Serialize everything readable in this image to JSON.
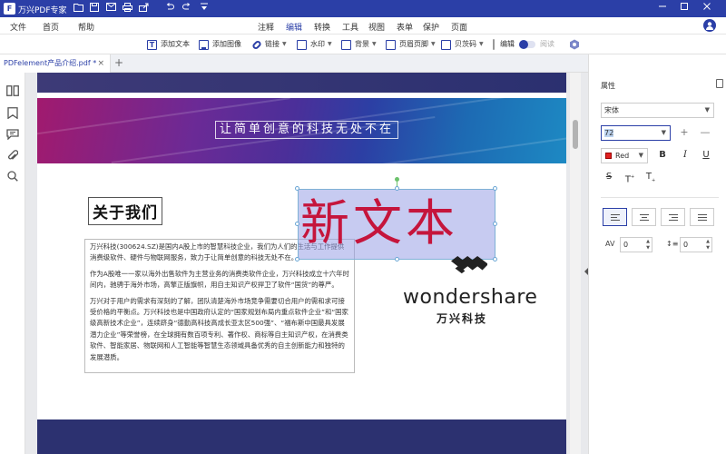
{
  "app": {
    "title": "万兴PDF专家",
    "logo_letter": "F"
  },
  "menu": {
    "file": "文件",
    "home": "首页",
    "help": "帮助",
    "tabs": [
      "注释",
      "编辑",
      "转换",
      "工具",
      "视图",
      "表单",
      "保护",
      "页面"
    ],
    "active_tab": "编辑"
  },
  "toolbar": {
    "add_text": "添加文本",
    "add_image": "添加图像",
    "link": "链接",
    "watermark": "水印",
    "background": "背景",
    "header_footer": "页眉页脚",
    "bates": "贝茨码",
    "edit_label": "编辑",
    "read_label": "阅读"
  },
  "tab": {
    "filename": "PDFelement产品介绍.pdf *",
    "close": "×",
    "new": "+"
  },
  "document": {
    "banner_text": "让简单创意的科技无处不在",
    "about_heading": "关于我们",
    "paragraphs": [
      "万兴科技(300624.SZ)是国内A股上市的智慧科技企业，我们为人们的生活与工作提供消费级软件、硬件与物联网服务，致力于让简单创意的科技无处不在。",
      "作为A股唯一一家以海外出售软件为主营业务的消费类软件企业，万兴科技成立十六年时间内，驰骋于海外市场，高擎正版旗帜，用自主知识产权捍卫了软件“国货”的尊严。",
      "万兴对于用户的需求有深刻的了解，团队清楚海外市场竞争需要切合用户的需和求可接受价格的平衡点。万兴科技也是中国政府认定的“国家规划布局内重点软件企业”和“国家级高新技术企业”，连续跻身“德勤高科技高成长亚太区500强”、“福布斯中国最具发展潜力企业”等荣誉榜，在全球拥有数百项专利、著作权、商标等自主知识产权，在消费类软件、智能家居、物联网和人工智能等智慧生态领域具备优秀的自主创新能力和独特的发展潜质。"
    ],
    "new_text": "新文本",
    "brand_word": "wondershare",
    "brand_cn": "万兴科技"
  },
  "properties": {
    "title": "属性",
    "font": "宋体",
    "size": "72",
    "color_label": "Red",
    "color_value": "#e02020",
    "bold": "B",
    "italic": "I",
    "underline": "U",
    "strike": "S",
    "superscript": "T",
    "subscript": "T",
    "char_spacing": "0",
    "line_spacing": "0",
    "plus": "+",
    "minus": "—"
  },
  "colors": {
    "brand": "#2b3fa7",
    "new_text": "#c5153c"
  }
}
